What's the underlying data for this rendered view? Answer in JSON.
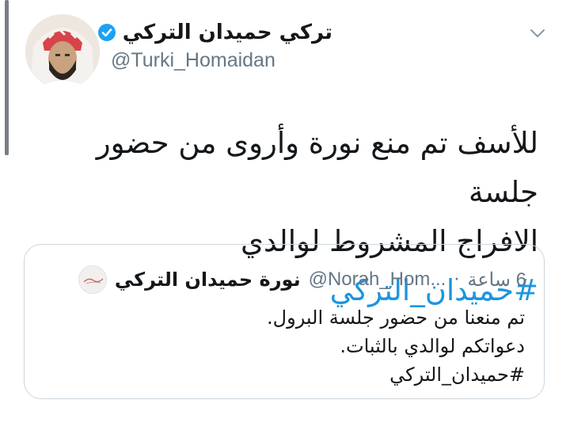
{
  "tweet": {
    "author_name": "تركي حميدان التركي",
    "author_handle": "@Turki_Homaidan",
    "verified_icon": "verified-badge-icon",
    "text_line1": "للأسف تم منع نورة وأروى من حضور جلسة",
    "text_line2_plain": "الافراج المشروط لوالدي ",
    "text_line2_hashtag": "#حميدان_التركي",
    "menu_icon": "chevron-down-icon"
  },
  "quoted_tweet": {
    "author_name": "نورة حميدان التركي",
    "author_handle": "@Norah_Hom...",
    "separator": "·",
    "time": "6 ساعة",
    "lines": [
      "تم منعنا من حضور جلسة البرول.",
      "دعواتكم لوالدي بالثبات.",
      "#حميدان_التركي"
    ]
  },
  "colors": {
    "text": "#14171a",
    "secondary": "#657786",
    "link": "#1b95e0",
    "verified": "#1da1f2",
    "border": "#ccd6dd"
  }
}
